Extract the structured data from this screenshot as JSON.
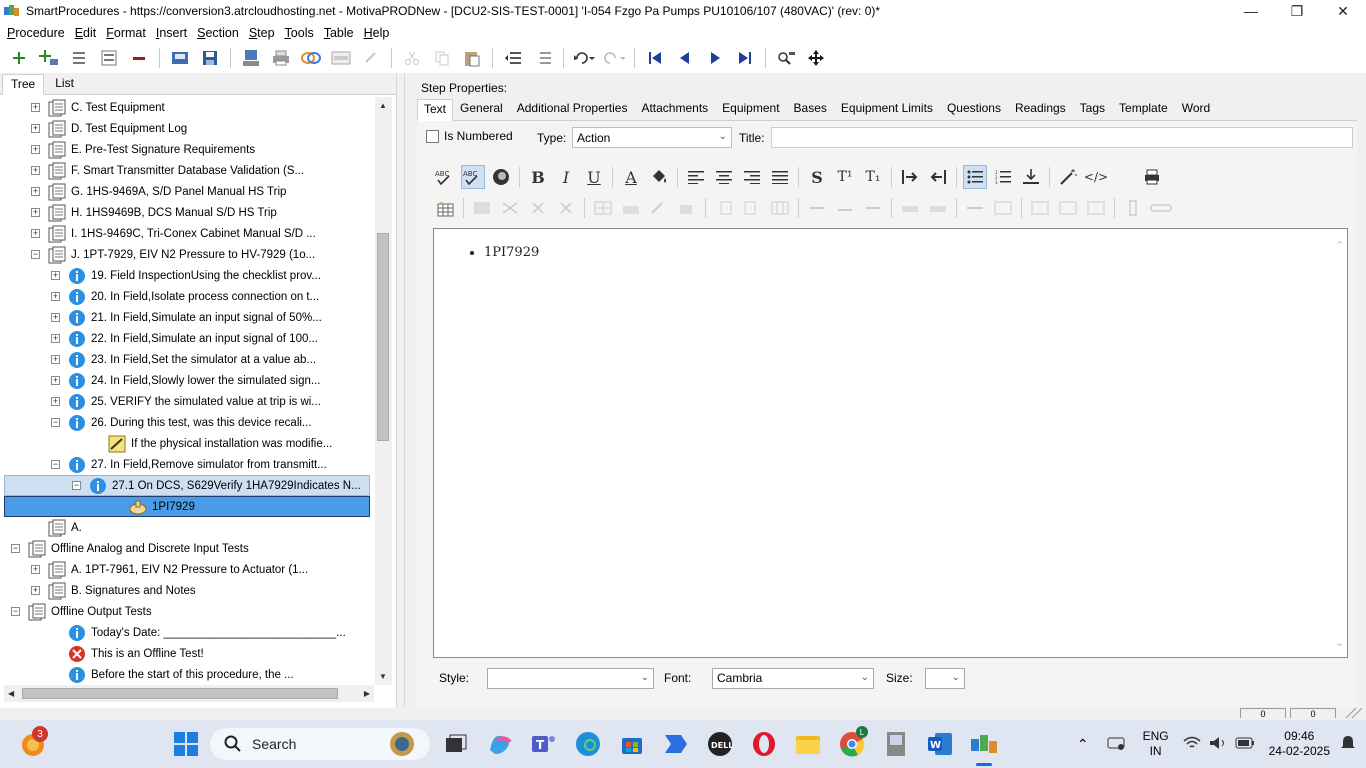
{
  "window": {
    "title": "SmartProcedures - https://conversion3.atrcloudhosting.net - MotivaPRODNew - [DCU2-SIS-TEST-0001] 'I-054 Fzgo Pa Pumps PU10106/107 (480VAC)' (rev: 0)*"
  },
  "menu": [
    {
      "label": "Procedure"
    },
    {
      "label": "Edit"
    },
    {
      "label": "Format"
    },
    {
      "label": "Insert"
    },
    {
      "label": "Section"
    },
    {
      "label": "Step"
    },
    {
      "label": "Tools"
    },
    {
      "label": "Table"
    },
    {
      "label": "Help"
    }
  ],
  "left_tabs": {
    "tree": "Tree",
    "list": "List"
  },
  "tree": [
    {
      "label": "C. Test Equipment"
    },
    {
      "label": "D. Test Equipment Log"
    },
    {
      "label": "E. Pre-Test Signature Requirements"
    },
    {
      "label": "F. Smart Transmitter Database Validation (S..."
    },
    {
      "label": "G. 1HS-9469A, S/D Panel Manual HS Trip"
    },
    {
      "label": "H. 1HS9469B, DCS Manual S/D HS Trip"
    },
    {
      "label": "I. 1HS-9469C, Tri-Conex Cabinet Manual S/D ..."
    },
    {
      "label": "J. 1PT-7929, EIV N2 Pressure to HV-7929 (1o..."
    },
    {
      "label": "19. Field InspectionUsing the checklist prov..."
    },
    {
      "label": "20. In Field,Isolate process connection on t..."
    },
    {
      "label": "21. In Field,Simulate an input signal of 50%..."
    },
    {
      "label": "22. In Field,Simulate an input signal of 100..."
    },
    {
      "label": "23. In Field,Set the simulator at a value ab..."
    },
    {
      "label": "24. In Field,Slowly lower the simulated sign..."
    },
    {
      "label": "25. VERIFY the simulated value at trip is wi..."
    },
    {
      "label": "26. During this test, was this device recali..."
    },
    {
      "label": "If the physical installation was modifie..."
    },
    {
      "label": "27. In Field,Remove simulator from transmitt..."
    },
    {
      "label": "27.1  On DCS,  S629Verify  1HA7929Indicates N..."
    },
    {
      "label": "1PI7929"
    },
    {
      "label": "A."
    },
    {
      "label": "Offline Analog and Discrete Input Tests"
    },
    {
      "label": "A. 1PT-7961, EIV N2 Pressure to Actuator (1..."
    },
    {
      "label": "B. Signatures and Notes"
    },
    {
      "label": "Offline Output Tests"
    },
    {
      "label": "Today's Date: ___________________________..."
    },
    {
      "label": "This is an Offline Test!"
    },
    {
      "label": "Before the start of this procedure, the ..."
    }
  ],
  "step_properties": {
    "heading": "Step Properties:",
    "tabs": [
      "Text",
      "General",
      "Additional Properties",
      "Attachments",
      "Equipment",
      "Bases",
      "Equipment Limits",
      "Questions",
      "Readings",
      "Tags",
      "Template",
      "Word"
    ],
    "is_numbered_label": "Is Numbered",
    "type_label": "Type:",
    "type_value": "Action",
    "title_label": "Title:",
    "title_value": "",
    "editor_bullet": "1PI7929",
    "style_label": "Style:",
    "style_value": "",
    "font_label": "Font:",
    "font_value": "Cambria",
    "size_label": "Size:",
    "size_value": ""
  },
  "format_toolbar": {
    "bold": "B",
    "italic": "I",
    "underline": "U",
    "font_color": "A",
    "strike": "S",
    "superscript": "T¹",
    "subscript": "T₁",
    "html": "</>"
  },
  "statusbar": {
    "box1": "0",
    "box2": "0"
  },
  "taskbar": {
    "search_placeholder": "Search",
    "lang": "ENG",
    "region": "IN",
    "time": "09:46",
    "date": "24-02-2025",
    "badge": "3"
  }
}
